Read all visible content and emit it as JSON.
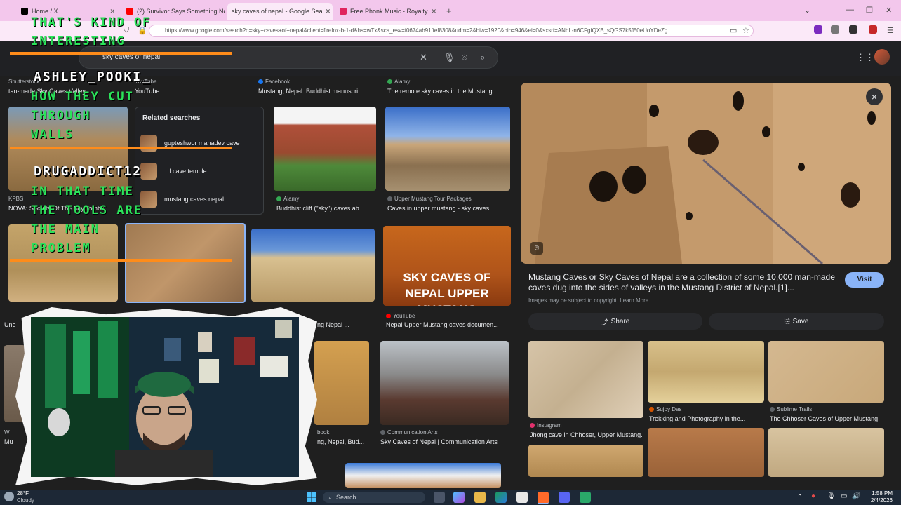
{
  "browser": {
    "tabs": [
      {
        "label": "Home / X",
        "color": "#000000",
        "active": false
      },
      {
        "label": "(2) Survivor Says Something No",
        "color": "#ff0000",
        "active": false
      },
      {
        "label": "sky caves of nepal - Google Sea",
        "color": "#4285f4",
        "active": true
      },
      {
        "label": "Free Phonk Music - Royalty",
        "color": "#e0245e",
        "active": false
      }
    ],
    "new_tab": "+",
    "url": "https://www.google.com/search?q=sky+caves+of+nepal&client=firefox-b-1-d&hs=wTx&sca_esv=f0674ab91ffef8308&udm=2&biw=1920&bih=946&ei=0&sxsrf=ANbL-n6CFgfQXB_sQGS7k5fE0eUoYDeZg"
  },
  "google": {
    "query": "sky caves of nepal",
    "apps_icon": "⋮⋮⋮"
  },
  "results": {
    "row1": [
      {
        "source": "Shutterstock",
        "caption": "tan-made Sky Caves Valley"
      },
      {
        "source": "YouTube",
        "caption": "YouTube"
      },
      {
        "source": "Facebook",
        "caption": "Mustang, Nepal. Buddhist manuscri..."
      },
      {
        "source": "Alamy",
        "caption": "The remote sky caves in the Mustang ..."
      }
    ],
    "row2": [
      {
        "source": "KPBS",
        "caption": "NOVA: Secrets Of The Sky Tombs"
      },
      {
        "source": "Alamy",
        "caption": "Buddhist cliff (\"sky\") caves ab..."
      },
      {
        "source": "Upper Mustang Tour Packages",
        "caption": "Caves in upper mustang - sky caves ..."
      }
    ],
    "row3": [
      {
        "source": "YouTube",
        "caption": "Nepal Upper Mustang caves documen..."
      },
      {
        "source": "T",
        "caption": "Une"
      },
      {
        "source": "",
        "caption": "ng Nepal ..."
      }
    ],
    "row4": [
      {
        "source": "Communication Arts",
        "caption": "Sky Caves of Nepal | Communication Arts"
      },
      {
        "source": "book",
        "caption": "ng, Nepal, Bud..."
      },
      {
        "source": "W",
        "caption": "Mu"
      }
    ],
    "sky_caves_thumb_text": "SKY CAVES OF NEPAL UPPER MUSTANG"
  },
  "related": {
    "title": "Related searches",
    "items": [
      "gupteshwor mahadev cave",
      "...l cave temple",
      "mustang caves nepal"
    ]
  },
  "preview": {
    "description": "Mustang Caves or Sky Caves of Nepal are a collection of some 10,000 man-made caves dug into the sides of valleys in the Mustang District of Nepal.[1]...",
    "visit": "Visit",
    "copyright": "Images may be subject to copyright. Learn More",
    "share": "Share",
    "save": "Save",
    "close": "×",
    "related_images": [
      {
        "source": "Instagram",
        "caption": "Jhong cave in Chhoser, Upper Mustang..."
      },
      {
        "source": "Sujoy Das",
        "caption": "Trekking and Photography in the..."
      },
      {
        "source": "Sublime Trails",
        "caption": "The Chhoser Caves of Upper Mustang"
      }
    ]
  },
  "overlay": {
    "chat_lines": [
      "THAT'S KIND OF INTERESTING",
      "ASHLEY_POOKI_",
      "HOW THEY CUT THROUGH WALLS",
      "DRUGADDICT12",
      "IN THAT TIME THE TOOLS ARE THE MAIN PROBLEM"
    ],
    "chat_display": [
      {
        "text": "THAT'S KIND OF",
        "style": "green"
      },
      {
        "text": "INTERESTING",
        "style": "green"
      },
      {
        "text": "ASHLEY_POOKI_",
        "style": "white"
      },
      {
        "text": "HOW THEY CUT",
        "style": "green"
      },
      {
        "text": "THROUGH",
        "style": "green"
      },
      {
        "text": "WALLS",
        "style": "green"
      },
      {
        "text": "DRUGADDICT12",
        "style": "white"
      },
      {
        "text": "IN THAT TIME",
        "style": "green"
      },
      {
        "text": "THE TOOLS ARE",
        "style": "green"
      },
      {
        "text": "THE MAIN",
        "style": "green"
      },
      {
        "text": "PROBLEM",
        "style": "green"
      }
    ]
  },
  "taskbar": {
    "weather_temp": "28°F",
    "weather_desc": "Cloudy",
    "search_placeholder": "Search",
    "time": "1:58 PM",
    "date": "2/4/2026"
  }
}
